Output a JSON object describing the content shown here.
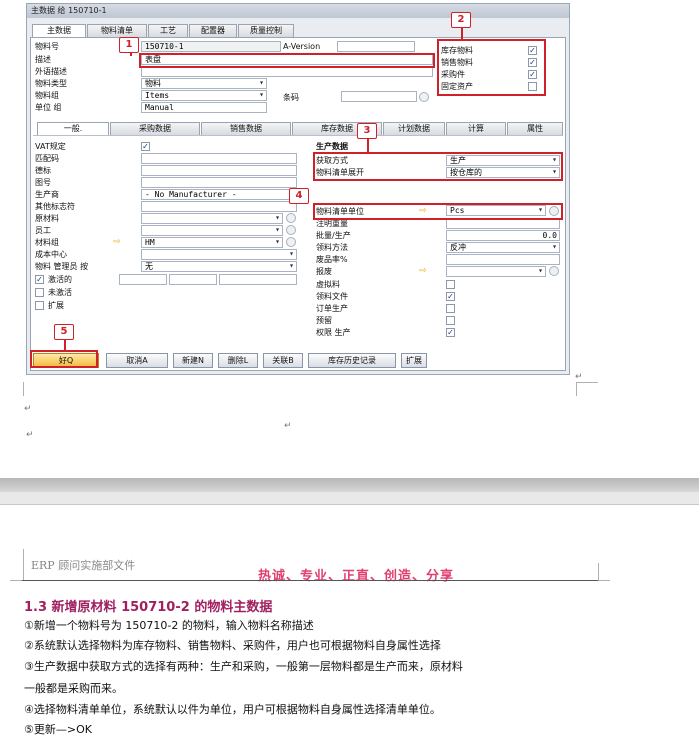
{
  "window": {
    "title": "主数据 给 150710-1"
  },
  "top_tabs": [
    "主数据",
    "物料清单",
    "工艺",
    "配置器",
    "质量控制"
  ],
  "header_fields": {
    "item_no_label": "物料号",
    "item_no_value": "150710-1",
    "a_version_label": "A-Version",
    "desc_label": "描述",
    "desc_value": "表盘",
    "foreign_desc_label": "外语描述",
    "item_type_label": "物料类型",
    "item_type_value": "物料",
    "item_group_label": "物料组",
    "item_group_value": "Items",
    "barcode_label": "条码",
    "uom_label": "单位 组",
    "uom_value": "Manual"
  },
  "item_flags": [
    {
      "label": "库存物料",
      "checked": true
    },
    {
      "label": "销售物料",
      "checked": true
    },
    {
      "label": "采购件",
      "checked": true
    },
    {
      "label": "固定资产",
      "checked": false
    }
  ],
  "sub_tabs": [
    "一般.",
    "采购数据",
    "销售数据",
    "库存数据",
    "计划数据",
    "计算",
    "属性"
  ],
  "general_left": {
    "vat_label": "VAT规定",
    "match_code_label": "匹配码",
    "dessin_label": "德标",
    "drawing_label": "图号",
    "manufacturer_label": "生产商",
    "manufacturer_value": "- No Manufacturer -",
    "other_id_label": "其他标志符",
    "raw_material_label": "原材料",
    "employee_label": "员工",
    "material_group_label": "材料组",
    "material_group_value": "HM",
    "cost_center_label": "成本中心",
    "manager_label": "物料 管理员 按",
    "manager_value": "无",
    "status_active": "激活的",
    "status_inactive": "未激活",
    "status_extend": "扩展"
  },
  "production": {
    "section_title": "生产数据",
    "procurement_label": "获取方式",
    "procurement_value": "生产",
    "bom_expand_label": "物料清单展开",
    "bom_expand_value": "按仓库的",
    "bom_uom_label": "物料清单单位",
    "bom_uom_value": "Pcs",
    "note_weight_label": "注明重量",
    "batch_label": "批量/生产",
    "batch_value": "0.0",
    "issue_method_label": "领料方法",
    "issue_method_value": "反冲",
    "scrap_label": "废品率%",
    "report_label": "报废",
    "phantom_label": "虚拟料",
    "issue_doc_label": "领料文件",
    "order_prod_label": "订单生产",
    "reserve_label": "预留",
    "auth_prod_label": "权限 生产"
  },
  "buttons": [
    "好Q",
    "取消A",
    "新建N",
    "删除L",
    "关联B",
    "库存历史记录",
    "扩展"
  ],
  "badges": [
    "1",
    "2",
    "3",
    "4",
    "5"
  ],
  "doc": {
    "header_left": "ERP 顾问实施部文件",
    "header_right": "热诚、专业、正直、创造、分享",
    "heading": "1.3 新增原材料 150710-2 的物料主数据",
    "lines": [
      "①新增一个物料号为 150710-2 的物料，输入物料名称描述",
      "②系统默认选择物料为库存物料、销售物料、采购件，用户也可根据物料自身属性选择",
      "③生产数据中获取方式的选择有两种：生产和采购，一般第一层物料都是生产而来，原材料",
      "一般都是采购而来。",
      "④选择物料清单单位，系统默认以件为单位，用户可根据物料自身属性选择清单单位。",
      "⑤更新—>OK"
    ]
  },
  "colors": {
    "highlight": "#d0202a",
    "heading": "#a02060",
    "slogan": "#e04070"
  }
}
